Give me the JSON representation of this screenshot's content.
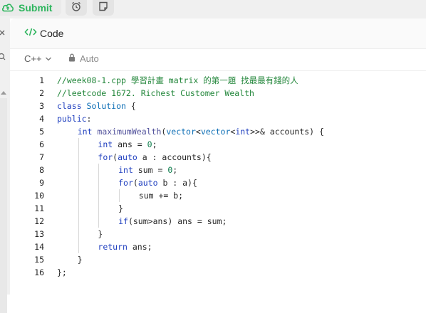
{
  "toolbar": {
    "submit_label": "Submit",
    "submit_color": "#2db55d"
  },
  "panel": {
    "tab_label": "Code",
    "language": "C++",
    "auto_label": "Auto"
  },
  "icons": {
    "submit": "cloud-upload-icon",
    "history": "alarm-clock-icon",
    "notes": "note-icon",
    "code": "code-brackets-icon",
    "lock": "lock-icon",
    "chevron": "chevron-down-icon"
  },
  "code_lines": [
    {
      "n": "1",
      "indent": 0,
      "tokens": [
        [
          "comment",
          "//week08-1.cpp 學習計畫 matrix 的第一題 找最最有錢的人"
        ]
      ]
    },
    {
      "n": "2",
      "indent": 0,
      "tokens": [
        [
          "comment",
          "//leetcode 1672. Richest Customer Wealth"
        ]
      ]
    },
    {
      "n": "3",
      "indent": 0,
      "tokens": [
        [
          "kw",
          "class "
        ],
        [
          "type",
          "Solution"
        ],
        [
          "plain",
          " {"
        ]
      ]
    },
    {
      "n": "4",
      "indent": 0,
      "tokens": [
        [
          "kw",
          "public"
        ],
        [
          "plain",
          ":"
        ]
      ]
    },
    {
      "n": "5",
      "indent": 1,
      "tokens": [
        [
          "kw",
          "int "
        ],
        [
          "fn",
          "maximumWealth"
        ],
        [
          "plain",
          "("
        ],
        [
          "type",
          "vector"
        ],
        [
          "plain",
          "<"
        ],
        [
          "type",
          "vector"
        ],
        [
          "plain",
          "<"
        ],
        [
          "kw",
          "int"
        ],
        [
          "plain",
          ">>& accounts) {"
        ]
      ]
    },
    {
      "n": "6",
      "indent": 2,
      "tokens": [
        [
          "kw",
          "int "
        ],
        [
          "plain",
          "ans = "
        ],
        [
          "num",
          "0"
        ],
        [
          "plain",
          ";"
        ]
      ]
    },
    {
      "n": "7",
      "indent": 2,
      "tokens": [
        [
          "kw",
          "for"
        ],
        [
          "plain",
          "("
        ],
        [
          "kw",
          "auto "
        ],
        [
          "plain",
          "a : accounts){"
        ]
      ]
    },
    {
      "n": "8",
      "indent": 3,
      "tokens": [
        [
          "kw",
          "int "
        ],
        [
          "plain",
          "sum = "
        ],
        [
          "num",
          "0"
        ],
        [
          "plain",
          ";"
        ]
      ]
    },
    {
      "n": "9",
      "indent": 3,
      "tokens": [
        [
          "kw",
          "for"
        ],
        [
          "plain",
          "("
        ],
        [
          "kw",
          "auto "
        ],
        [
          "plain",
          "b : a){"
        ]
      ]
    },
    {
      "n": "10",
      "indent": 4,
      "tokens": [
        [
          "plain",
          "sum += b;"
        ]
      ]
    },
    {
      "n": "11",
      "indent": 3,
      "tokens": [
        [
          "plain",
          "}"
        ]
      ]
    },
    {
      "n": "12",
      "indent": 3,
      "tokens": [
        [
          "kw",
          "if"
        ],
        [
          "plain",
          "(sum>ans) ans = sum;"
        ]
      ]
    },
    {
      "n": "13",
      "indent": 2,
      "tokens": [
        [
          "plain",
          "}"
        ]
      ]
    },
    {
      "n": "14",
      "indent": 2,
      "tokens": [
        [
          "kw",
          "return "
        ],
        [
          "plain",
          "ans;"
        ]
      ]
    },
    {
      "n": "15",
      "indent": 1,
      "tokens": [
        [
          "plain",
          "}"
        ]
      ]
    },
    {
      "n": "16",
      "indent": 0,
      "tokens": [
        [
          "plain",
          "};"
        ]
      ]
    }
  ]
}
